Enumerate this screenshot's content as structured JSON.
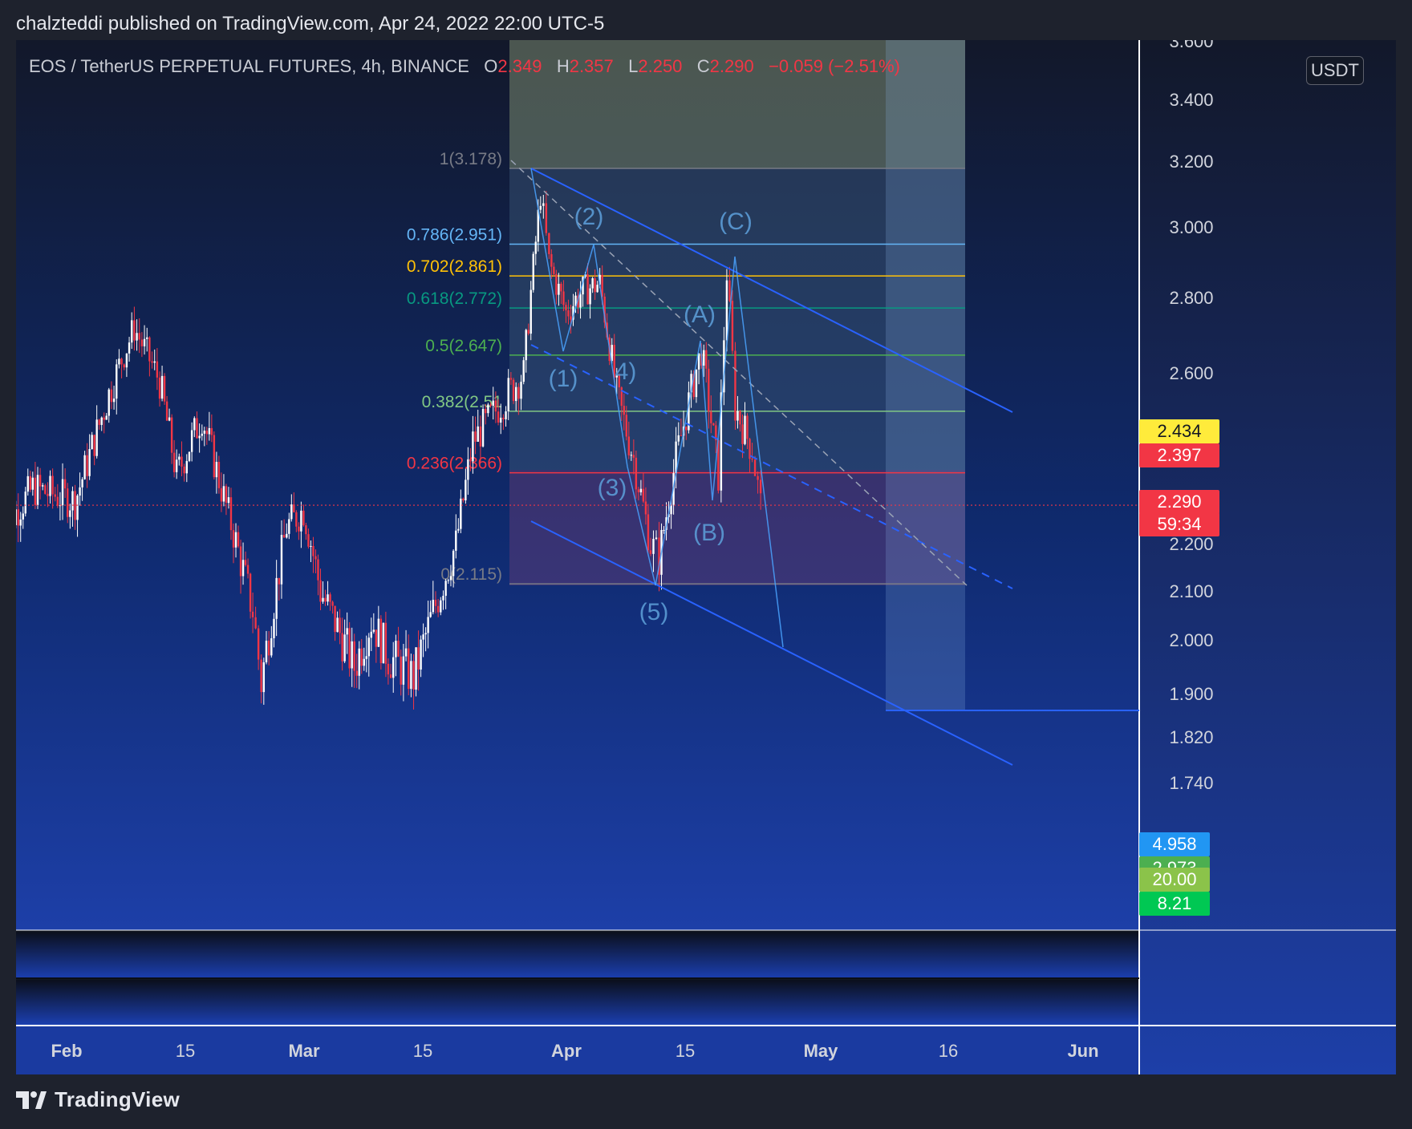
{
  "publisher_line": "chalzteddi published on TradingView.com, Apr 24, 2022 22:00 UTC-5",
  "header": {
    "symbol": "EOS / TetherUS PERPETUAL FUTURES, 4h, BINANCE",
    "o_label": "O",
    "o_value": "2.349",
    "h_label": "H",
    "h_value": "2.357",
    "l_label": "L",
    "l_value": "2.250",
    "c_label": "C",
    "c_value": "2.290",
    "change": "−0.059 (−2.51%)"
  },
  "unit": "USDT",
  "colors": {
    "up": "#ffffff",
    "down": "#f23645",
    "channel": "#2962ff",
    "wave_label": "#5b9bd5",
    "badge_yellow": "#ffeb3b",
    "badge_red": "#f23645",
    "badge_blue": "#2196f3",
    "badge_green1": "#4caf50",
    "badge_green2": "#8bc34a",
    "badge_green3": "#00c853"
  },
  "chart_data": {
    "type": "candlestick",
    "interval": "4h",
    "y_axis_ticks": [
      "3.600",
      "3.400",
      "3.200",
      "3.000",
      "2.800",
      "2.600",
      "2.200",
      "2.100",
      "2.000",
      "1.900",
      "1.820",
      "1.740"
    ],
    "x_axis_ticks": [
      "Feb",
      "15",
      "Mar",
      "15",
      "Apr",
      "15",
      "May",
      "16",
      "Jun"
    ],
    "price_series": [
      {
        "date": "Jan 24",
        "close": 2.22
      },
      {
        "date": "Jan 28",
        "close": 2.33
      },
      {
        "date": "Feb 2",
        "close": 2.3
      },
      {
        "date": "Feb 6",
        "close": 2.55
      },
      {
        "date": "Feb 9",
        "close": 2.72
      },
      {
        "date": "Feb 12",
        "close": 2.58
      },
      {
        "date": "Feb 14",
        "close": 2.36
      },
      {
        "date": "Feb 17",
        "close": 2.5
      },
      {
        "date": "Feb 19",
        "close": 2.35
      },
      {
        "date": "Feb 23",
        "close": 2.06
      },
      {
        "date": "Feb 24",
        "close": 1.92
      },
      {
        "date": "Feb 27",
        "close": 2.24
      },
      {
        "date": "Mar 1",
        "close": 2.28
      },
      {
        "date": "Mar 3",
        "close": 2.1
      },
      {
        "date": "Mar 7",
        "close": 1.95
      },
      {
        "date": "Mar 9",
        "close": 2.04
      },
      {
        "date": "Mar 11",
        "close": 1.97
      },
      {
        "date": "Mar 14",
        "close": 1.93
      },
      {
        "date": "Mar 16",
        "close": 2.04
      },
      {
        "date": "Mar 19",
        "close": 2.2
      },
      {
        "date": "Mar 21",
        "close": 2.44
      },
      {
        "date": "Mar 24",
        "close": 2.52
      },
      {
        "date": "Mar 27",
        "close": 2.6
      },
      {
        "date": "Mar 29",
        "close": 3.1
      },
      {
        "date": "Mar 30",
        "close": 2.9
      },
      {
        "date": "Apr 1",
        "close": 2.76
      },
      {
        "date": "Apr 3",
        "close": 2.82
      },
      {
        "date": "Apr 5",
        "close": 2.84
      },
      {
        "date": "Apr 7",
        "close": 2.55
      },
      {
        "date": "Apr 9",
        "close": 2.4
      },
      {
        "date": "Apr 11",
        "close": 2.2
      },
      {
        "date": "Apr 12",
        "close": 2.17
      },
      {
        "date": "Apr 14",
        "close": 2.4
      },
      {
        "date": "Apr 17",
        "close": 2.66
      },
      {
        "date": "Apr 19",
        "close": 2.36
      },
      {
        "date": "Apr 20",
        "close": 2.87
      },
      {
        "date": "Apr 21",
        "close": 2.52
      },
      {
        "date": "Apr 23",
        "close": 2.42
      },
      {
        "date": "Apr 24",
        "close": 2.29
      }
    ],
    "fib_levels": [
      {
        "label": "1(3.178)",
        "value": 3.178,
        "color": "#787b86"
      },
      {
        "label": "0.786(2.951)",
        "value": 2.951,
        "color": "#64b5f6"
      },
      {
        "label": "0.702(2.861)",
        "value": 2.861,
        "color": "#ffc107"
      },
      {
        "label": "0.618(2.772)",
        "value": 2.772,
        "color": "#089981"
      },
      {
        "label": "0.5(2.647)",
        "value": 2.647,
        "color": "#4caf50"
      },
      {
        "label": "0.382(2.51",
        "value": 2.51,
        "color": "#81c784"
      },
      {
        "label": "0.236(2.366)",
        "value": 2.366,
        "color": "#f23645"
      },
      {
        "label": "0(2.115)",
        "value": 2.115,
        "color": "#787b86"
      }
    ],
    "wave_labels": [
      "(1)",
      "(2)",
      "(3)",
      "4)",
      "(5)",
      "(A)",
      "(B)",
      "(C)"
    ],
    "price_badges": [
      {
        "value": "2.434",
        "color": "#ffeb3b",
        "text_color": "#131722"
      },
      {
        "value": "2.397",
        "color": "#f23645",
        "text_color": "#ffffff"
      },
      {
        "value": "2.290",
        "color": "#f23645",
        "text_color": "#ffffff"
      },
      {
        "value": "59:34",
        "color": "#f23645",
        "text_color": "#ffffff"
      }
    ],
    "indicator_badges": [
      {
        "value": "4.958",
        "color": "#2196f3"
      },
      {
        "value": "2.973",
        "color": "#4caf50"
      },
      {
        "value": "20.00",
        "color": "#8bc34a"
      },
      {
        "value": "8.21",
        "color": "#00c853"
      }
    ]
  },
  "footer": {
    "brand": "TradingView"
  }
}
